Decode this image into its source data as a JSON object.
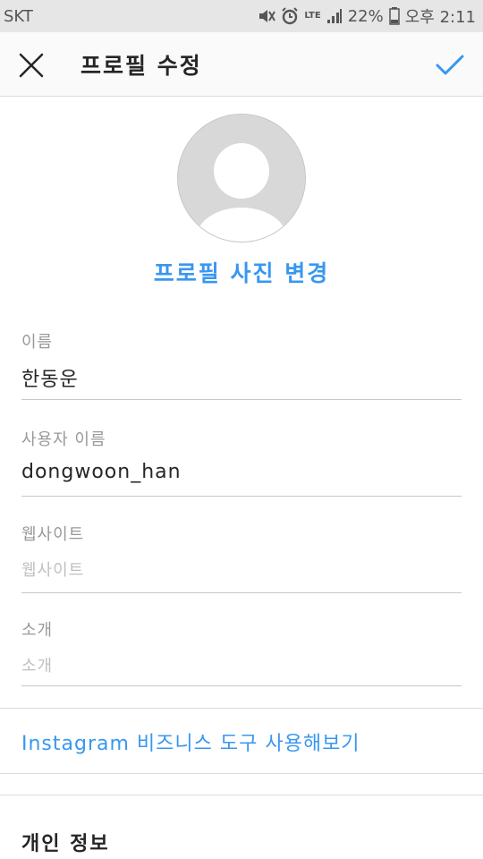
{
  "status_bar": {
    "carrier": "SKT",
    "network": "LTE",
    "battery": "22%",
    "time": "오후 2:11"
  },
  "header": {
    "title": "프로필 수정",
    "close_icon": "close-icon",
    "done_icon": "checkmark-icon",
    "accent_color": "#3897f0"
  },
  "profile": {
    "avatar_icon": "default-avatar-icon",
    "change_photo_label": "프로필 사진 변경"
  },
  "fields": [
    {
      "label": "이름",
      "value": "한동운",
      "placeholder": ""
    },
    {
      "label": "사용자 이름",
      "value": "dongwoon_han",
      "placeholder": ""
    },
    {
      "label": "웹사이트",
      "value": "",
      "placeholder": "웹사이트"
    },
    {
      "label": "소개",
      "value": "",
      "placeholder": "소개"
    }
  ],
  "business_link": "Instagram 비즈니스 도구 사용해보기",
  "private_info": {
    "title": "개인 정보"
  }
}
